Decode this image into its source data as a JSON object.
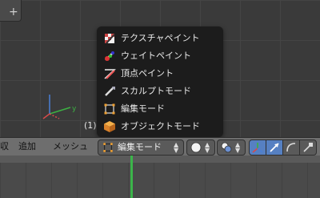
{
  "viewport": {
    "frame_label": "(1)"
  },
  "mode_menu": {
    "items": [
      {
        "label": "テクスチャペイント",
        "icon": "texture-paint-icon"
      },
      {
        "label": "ウェイトペイント",
        "icon": "weight-paint-icon"
      },
      {
        "label": "頂点ペイント",
        "icon": "vertex-paint-icon"
      },
      {
        "label": "スカルプトモード",
        "icon": "sculpt-mode-icon"
      },
      {
        "label": "編集モード",
        "icon": "edit-mode-icon"
      },
      {
        "label": "オブジェクトモード",
        "icon": "object-mode-icon"
      }
    ]
  },
  "header": {
    "menu_partial": "収",
    "menu_add": "追加",
    "menu_mesh": "メッシュ",
    "mode_selector": "編集モード"
  },
  "colors": {
    "accent_blue": "#5680c2",
    "frame_green": "#3bb54a",
    "menu_bg": "#1c1c1c"
  }
}
